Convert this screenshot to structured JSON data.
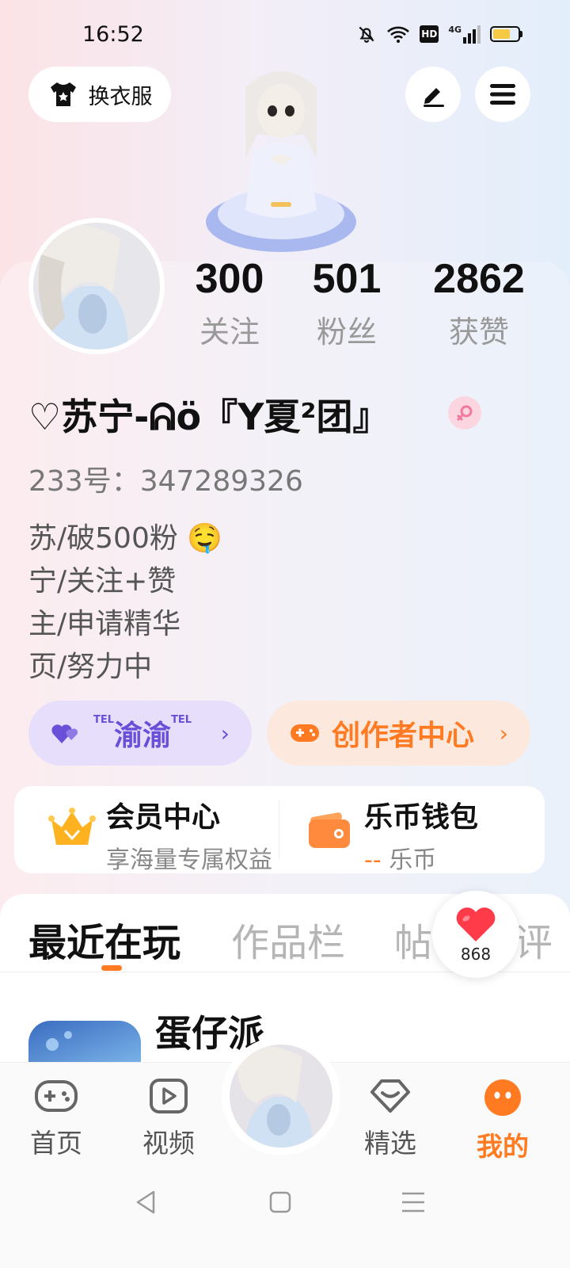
{
  "status_bar": {
    "time": "16:52",
    "icons": [
      "mute-bell-icon",
      "wifi-icon",
      "hd-icon",
      "signal-4g-icon",
      "battery-icon"
    ],
    "hd_label": "HD",
    "net_label": "4G"
  },
  "top_bar": {
    "change_clothes_label": "换衣服",
    "edit_icon": "pen-icon",
    "menu_icon": "hamburger-menu-icon"
  },
  "stats": [
    {
      "value": "300",
      "label": "关注"
    },
    {
      "value": "501",
      "label": "粉丝"
    },
    {
      "value": "2862",
      "label": "获赞"
    }
  ],
  "profile": {
    "username": "♡苏宁-ᕱö『Y夏²团』",
    "gender": "female",
    "uid_text": "233号：347289326",
    "bio": [
      "苏/破500粉 🤤",
      "宁/关注+赞",
      "主/申请精华",
      "页/努力中"
    ]
  },
  "tags": {
    "group": {
      "label": "渝渝",
      "prefix": "TEL",
      "suffix": "TEL"
    },
    "creator": {
      "label": "创作者中心"
    }
  },
  "cards": {
    "vip": {
      "title": "会员中心",
      "subtitle": "享海量专属权益"
    },
    "wallet": {
      "title": "乐币钱包",
      "subtitle": "乐币",
      "amount": "--"
    }
  },
  "tabs": [
    {
      "label": "最近在玩",
      "active": true
    },
    {
      "label": "作品栏",
      "active": false
    },
    {
      "label": "帖",
      "active": false
    },
    {
      "label": "评",
      "active": false
    }
  ],
  "like_bubble": {
    "count": "868"
  },
  "recent_game": {
    "name": "蛋仔派"
  },
  "bottom_nav": [
    {
      "label": "首页",
      "active": false
    },
    {
      "label": "视频",
      "active": false
    },
    {
      "label": "精选",
      "active": false
    },
    {
      "label": "我的",
      "active": true
    }
  ],
  "colors": {
    "accent": "#ff7a20",
    "purple": "#6a4fd8",
    "pink": "#f27aa0"
  }
}
